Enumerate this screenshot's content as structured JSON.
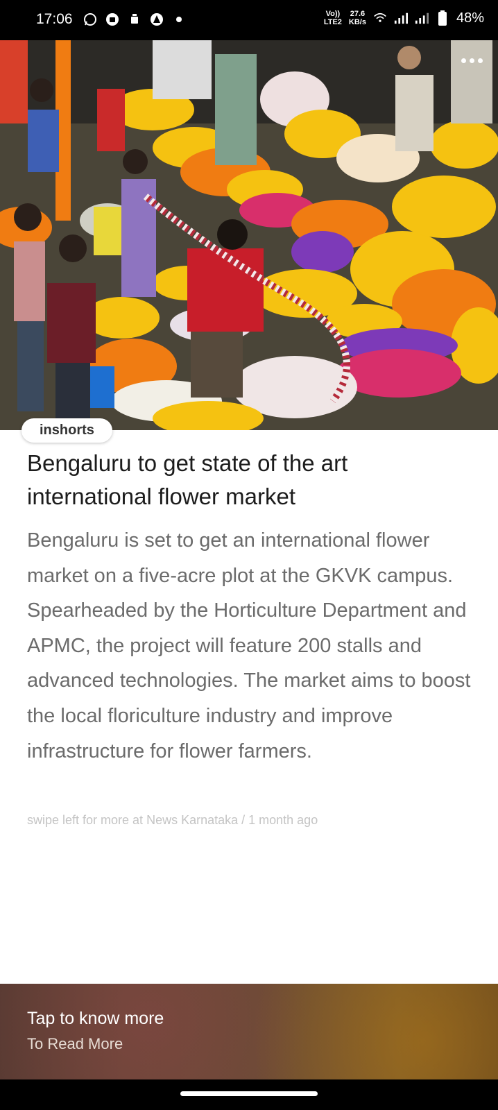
{
  "status_bar": {
    "time": "17:06",
    "left_icons": [
      "whatsapp-icon",
      "bag-icon",
      "notification-icon",
      "alert-icon",
      "dot-icon"
    ],
    "network_label_top": "Vo))",
    "network_label_bottom": "LTE2",
    "speed_value": "27.6",
    "speed_unit": "KB/s",
    "battery_percent": "48%"
  },
  "article": {
    "source_badge": "inshorts",
    "headline": "Bengaluru to get state of the art international flower market",
    "summary": "Bengaluru is set to get an international flower market on a five-acre plot at the GKVK campus. Spearheaded by the Horticulture Department and APMC, the project will feature 200 stalls and advanced technologies. The market aims to boost the local floriculture industry and improve infrastructure for flower farmers.",
    "footnote": "swipe left for more at News Karnataka / 1 month ago"
  },
  "banner": {
    "title": "Tap to know more",
    "subtitle": "To Read More"
  },
  "colors": {
    "headline": "#1c1c1c",
    "summary": "#6b6b6b",
    "footnote": "#c4c4c4",
    "marigold_orange": "#f07c12",
    "marigold_yellow": "#f5c211"
  }
}
